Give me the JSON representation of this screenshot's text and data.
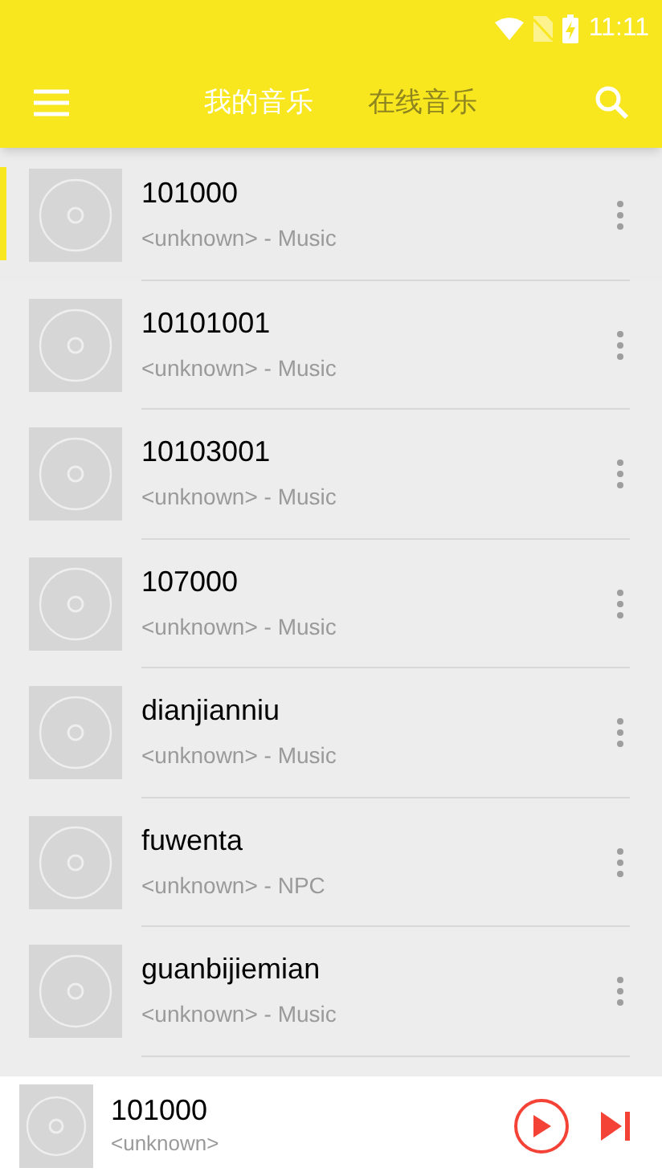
{
  "status_bar": {
    "time": "11:11"
  },
  "tabs": [
    {
      "label": "我的音乐",
      "selected": true
    },
    {
      "label": "在线音乐",
      "selected": false
    }
  ],
  "songs": [
    {
      "title": "101000",
      "subtitle": "<unknown> - Music",
      "selected": true
    },
    {
      "title": "10101001",
      "subtitle": "<unknown> - Music",
      "selected": false
    },
    {
      "title": "10103001",
      "subtitle": "<unknown> - Music",
      "selected": false
    },
    {
      "title": "107000",
      "subtitle": "<unknown> - Music",
      "selected": false
    },
    {
      "title": "dianjianniu",
      "subtitle": "<unknown> - Music",
      "selected": false
    },
    {
      "title": "fuwenta",
      "subtitle": "<unknown> - NPC",
      "selected": false
    },
    {
      "title": "guanbijiemian",
      "subtitle": "<unknown> - Music",
      "selected": false
    }
  ],
  "player": {
    "title": "101000",
    "artist": "<unknown>"
  }
}
